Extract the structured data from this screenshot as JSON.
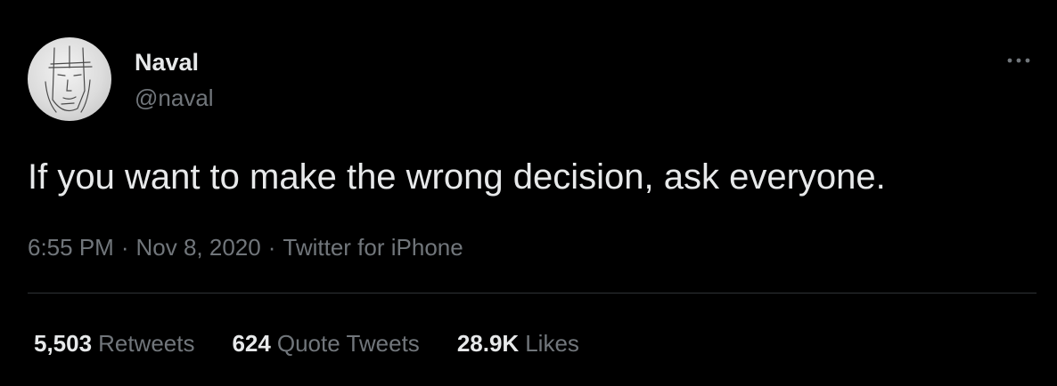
{
  "author": {
    "display_name": "Naval",
    "handle": "@naval",
    "avatar_icon": "sketched-face-avatar"
  },
  "tweet": {
    "text": "If you want to make the wrong decision, ask everyone.",
    "time": "6:55 PM",
    "date": "Nov 8, 2020",
    "source": "Twitter for iPhone",
    "separator": "·"
  },
  "stats": {
    "retweets_count": "5,503",
    "retweets_label": "Retweets",
    "quotes_count": "624",
    "quotes_label": "Quote Tweets",
    "likes_count": "28.9K",
    "likes_label": "Likes"
  },
  "icons": {
    "more": "more-horizontal-icon"
  },
  "colors": {
    "background": "#000000",
    "primary_text": "#e7e9ea",
    "secondary_text": "#71767b",
    "divider": "#2f3336"
  }
}
